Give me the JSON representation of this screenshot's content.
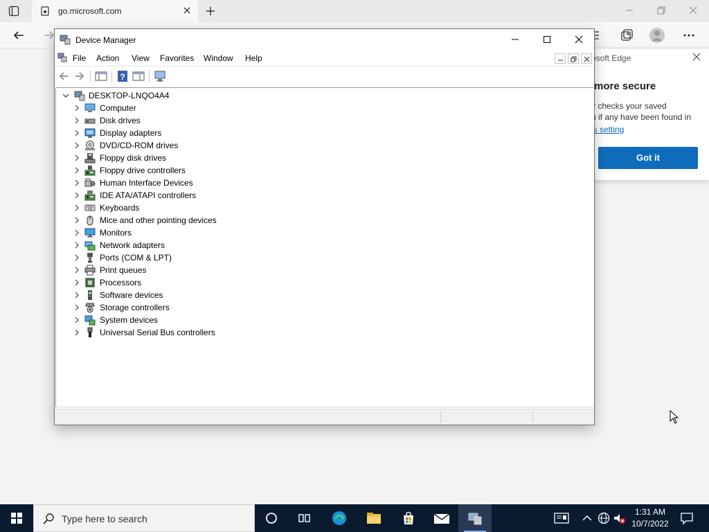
{
  "browser": {
    "tab_title": "go.microsoft.com",
    "popup": {
      "header": "osoft Edge",
      "heading": "more secure",
      "body_line1": "y checks your saved",
      "body_line2": "u if any have been found in",
      "link": "is setting",
      "button": "Got it"
    }
  },
  "device_manager": {
    "title": "Device Manager",
    "menu": [
      "File",
      "Action",
      "View",
      "Favorites",
      "Window",
      "Help"
    ],
    "root": "DESKTOP-LNQO4A4",
    "categories": [
      {
        "label": "Computer",
        "icon": "computer-icon"
      },
      {
        "label": "Disk drives",
        "icon": "disk-drive-icon"
      },
      {
        "label": "Display adapters",
        "icon": "display-adapter-icon"
      },
      {
        "label": "DVD/CD-ROM drives",
        "icon": "dvd-drive-icon"
      },
      {
        "label": "Floppy disk drives",
        "icon": "floppy-disk-icon"
      },
      {
        "label": "Floppy drive controllers",
        "icon": "floppy-controller-icon"
      },
      {
        "label": "Human Interface Devices",
        "icon": "hid-icon"
      },
      {
        "label": "IDE ATA/ATAPI controllers",
        "icon": "ide-controller-icon"
      },
      {
        "label": "Keyboards",
        "icon": "keyboard-icon"
      },
      {
        "label": "Mice and other pointing devices",
        "icon": "mouse-icon"
      },
      {
        "label": "Monitors",
        "icon": "monitor-icon"
      },
      {
        "label": "Network adapters",
        "icon": "network-adapter-icon"
      },
      {
        "label": "Ports (COM & LPT)",
        "icon": "port-icon"
      },
      {
        "label": "Print queues",
        "icon": "printer-icon"
      },
      {
        "label": "Processors",
        "icon": "processor-icon"
      },
      {
        "label": "Software devices",
        "icon": "software-device-icon"
      },
      {
        "label": "Storage controllers",
        "icon": "storage-controller-icon"
      },
      {
        "label": "System devices",
        "icon": "system-device-icon"
      },
      {
        "label": "Universal Serial Bus controllers",
        "icon": "usb-icon"
      }
    ]
  },
  "taskbar": {
    "search_placeholder": "Type here to search",
    "time": "1:31 AM",
    "date": "10/7/2022"
  }
}
